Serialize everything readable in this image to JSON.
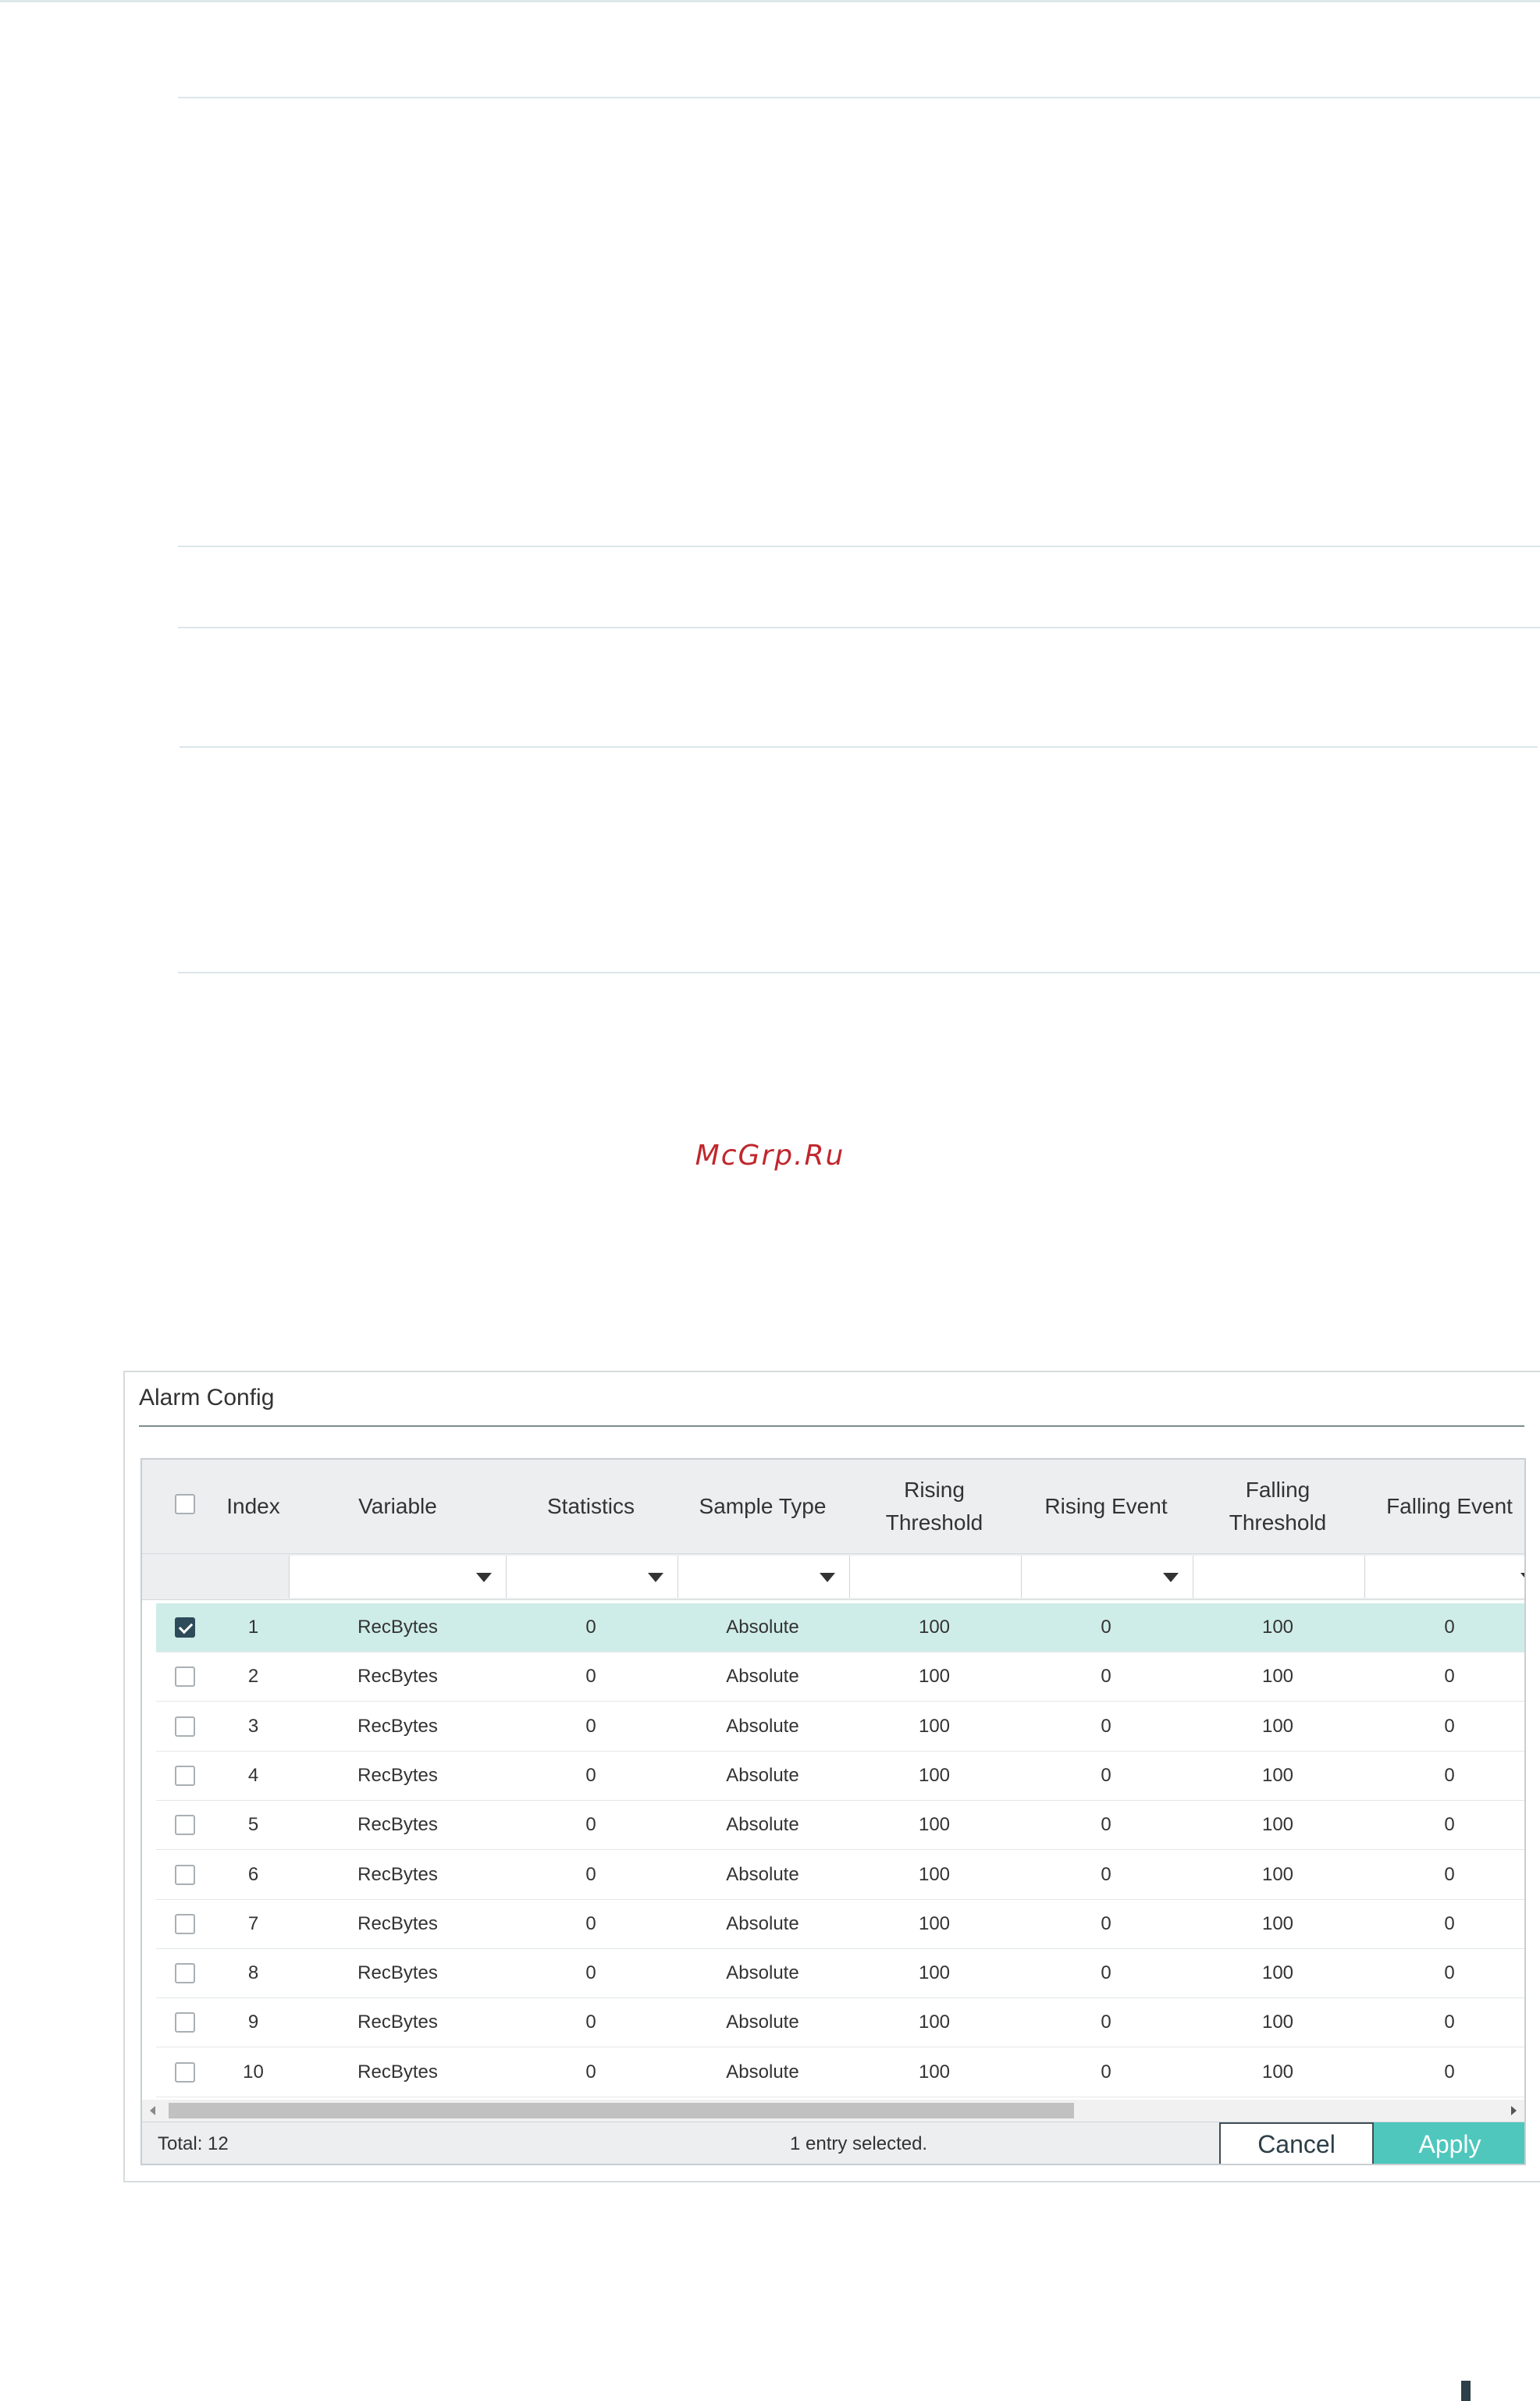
{
  "watermark": "McGrp.Ru",
  "panel": {
    "title": "Alarm Config"
  },
  "columns": {
    "index": "Index",
    "variable": "Variable",
    "statistics": "Statistics",
    "sample_type": "Sample Type",
    "rising_threshold_1": "Rising",
    "rising_threshold_2": "Threshold",
    "rising_event": "Rising Event",
    "falling_threshold_1": "Falling",
    "falling_threshold_2": "Threshold",
    "falling_event": "Falling Event"
  },
  "rows": [
    {
      "index": "1",
      "variable": "RecBytes",
      "statistics": "0",
      "sample_type": "Absolute",
      "rising_threshold": "100",
      "rising_event": "0",
      "falling_threshold": "100",
      "falling_event": "0",
      "checked": true
    },
    {
      "index": "2",
      "variable": "RecBytes",
      "statistics": "0",
      "sample_type": "Absolute",
      "rising_threshold": "100",
      "rising_event": "0",
      "falling_threshold": "100",
      "falling_event": "0",
      "checked": false
    },
    {
      "index": "3",
      "variable": "RecBytes",
      "statistics": "0",
      "sample_type": "Absolute",
      "rising_threshold": "100",
      "rising_event": "0",
      "falling_threshold": "100",
      "falling_event": "0",
      "checked": false
    },
    {
      "index": "4",
      "variable": "RecBytes",
      "statistics": "0",
      "sample_type": "Absolute",
      "rising_threshold": "100",
      "rising_event": "0",
      "falling_threshold": "100",
      "falling_event": "0",
      "checked": false
    },
    {
      "index": "5",
      "variable": "RecBytes",
      "statistics": "0",
      "sample_type": "Absolute",
      "rising_threshold": "100",
      "rising_event": "0",
      "falling_threshold": "100",
      "falling_event": "0",
      "checked": false
    },
    {
      "index": "6",
      "variable": "RecBytes",
      "statistics": "0",
      "sample_type": "Absolute",
      "rising_threshold": "100",
      "rising_event": "0",
      "falling_threshold": "100",
      "falling_event": "0",
      "checked": false
    },
    {
      "index": "7",
      "variable": "RecBytes",
      "statistics": "0",
      "sample_type": "Absolute",
      "rising_threshold": "100",
      "rising_event": "0",
      "falling_threshold": "100",
      "falling_event": "0",
      "checked": false
    },
    {
      "index": "8",
      "variable": "RecBytes",
      "statistics": "0",
      "sample_type": "Absolute",
      "rising_threshold": "100",
      "rising_event": "0",
      "falling_threshold": "100",
      "falling_event": "0",
      "checked": false
    },
    {
      "index": "9",
      "variable": "RecBytes",
      "statistics": "0",
      "sample_type": "Absolute",
      "rising_threshold": "100",
      "rising_event": "0",
      "falling_threshold": "100",
      "falling_event": "0",
      "checked": false
    },
    {
      "index": "10",
      "variable": "RecBytes",
      "statistics": "0",
      "sample_type": "Absolute",
      "rising_threshold": "100",
      "rising_event": "0",
      "falling_threshold": "100",
      "falling_event": "0",
      "checked": false
    }
  ],
  "footer": {
    "total": "Total: 12",
    "selection": "1 entry selected.",
    "cancel_label": "Cancel",
    "apply_label": "Apply"
  },
  "colors": {
    "selected_row": "#cfede8",
    "apply_button": "#4fc7bd",
    "checkbox_checked": "#2d4b5a",
    "watermark": "#c0272d"
  },
  "icons": {
    "dropdown": "caret-down-icon",
    "checkbox": "checkbox-icon",
    "scroll_left": "arrow-left-icon",
    "scroll_right": "arrow-right-icon"
  }
}
